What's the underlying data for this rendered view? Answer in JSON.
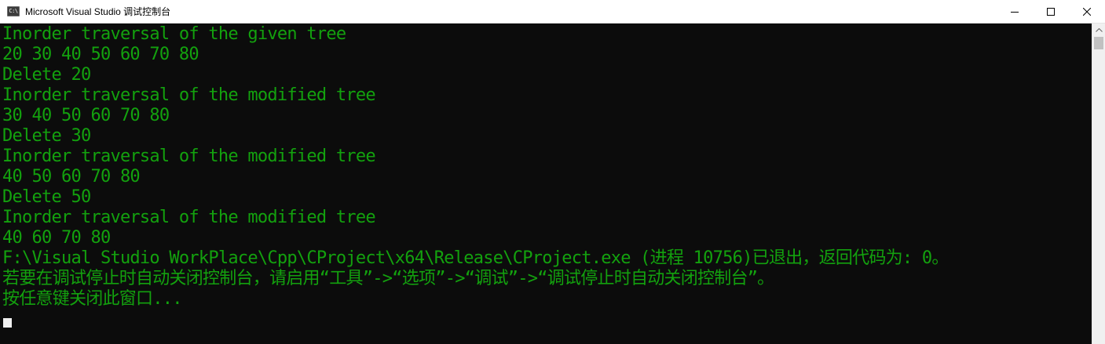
{
  "window": {
    "title": "Microsoft Visual Studio 调试控制台",
    "icon": "console-app-icon",
    "icon_label": "C:\\",
    "controls": {
      "minimize": "minimize-icon",
      "maximize": "maximize-icon",
      "close": "close-icon"
    }
  },
  "console": {
    "lines": [
      "Inorder traversal of the given tree",
      "20 30 40 50 60 70 80",
      "Delete 20",
      "Inorder traversal of the modified tree",
      "30 40 50 60 70 80",
      "Delete 30",
      "Inorder traversal of the modified tree",
      "40 50 60 70 80",
      "Delete 50",
      "Inorder traversal of the modified tree",
      "40 60 70 80",
      "F:\\Visual Studio WorkPlace\\Cpp\\CProject\\x64\\Release\\CProject.exe (进程 10756)已退出，返回代码为: 0。",
      "若要在调试停止时自动关闭控制台，请启用“工具”->“选项”->“调试”->“调试停止时自动关闭控制台”。",
      "按任意键关闭此窗口..."
    ],
    "text_color": "#13a10e",
    "background": "#0c0c0c"
  }
}
